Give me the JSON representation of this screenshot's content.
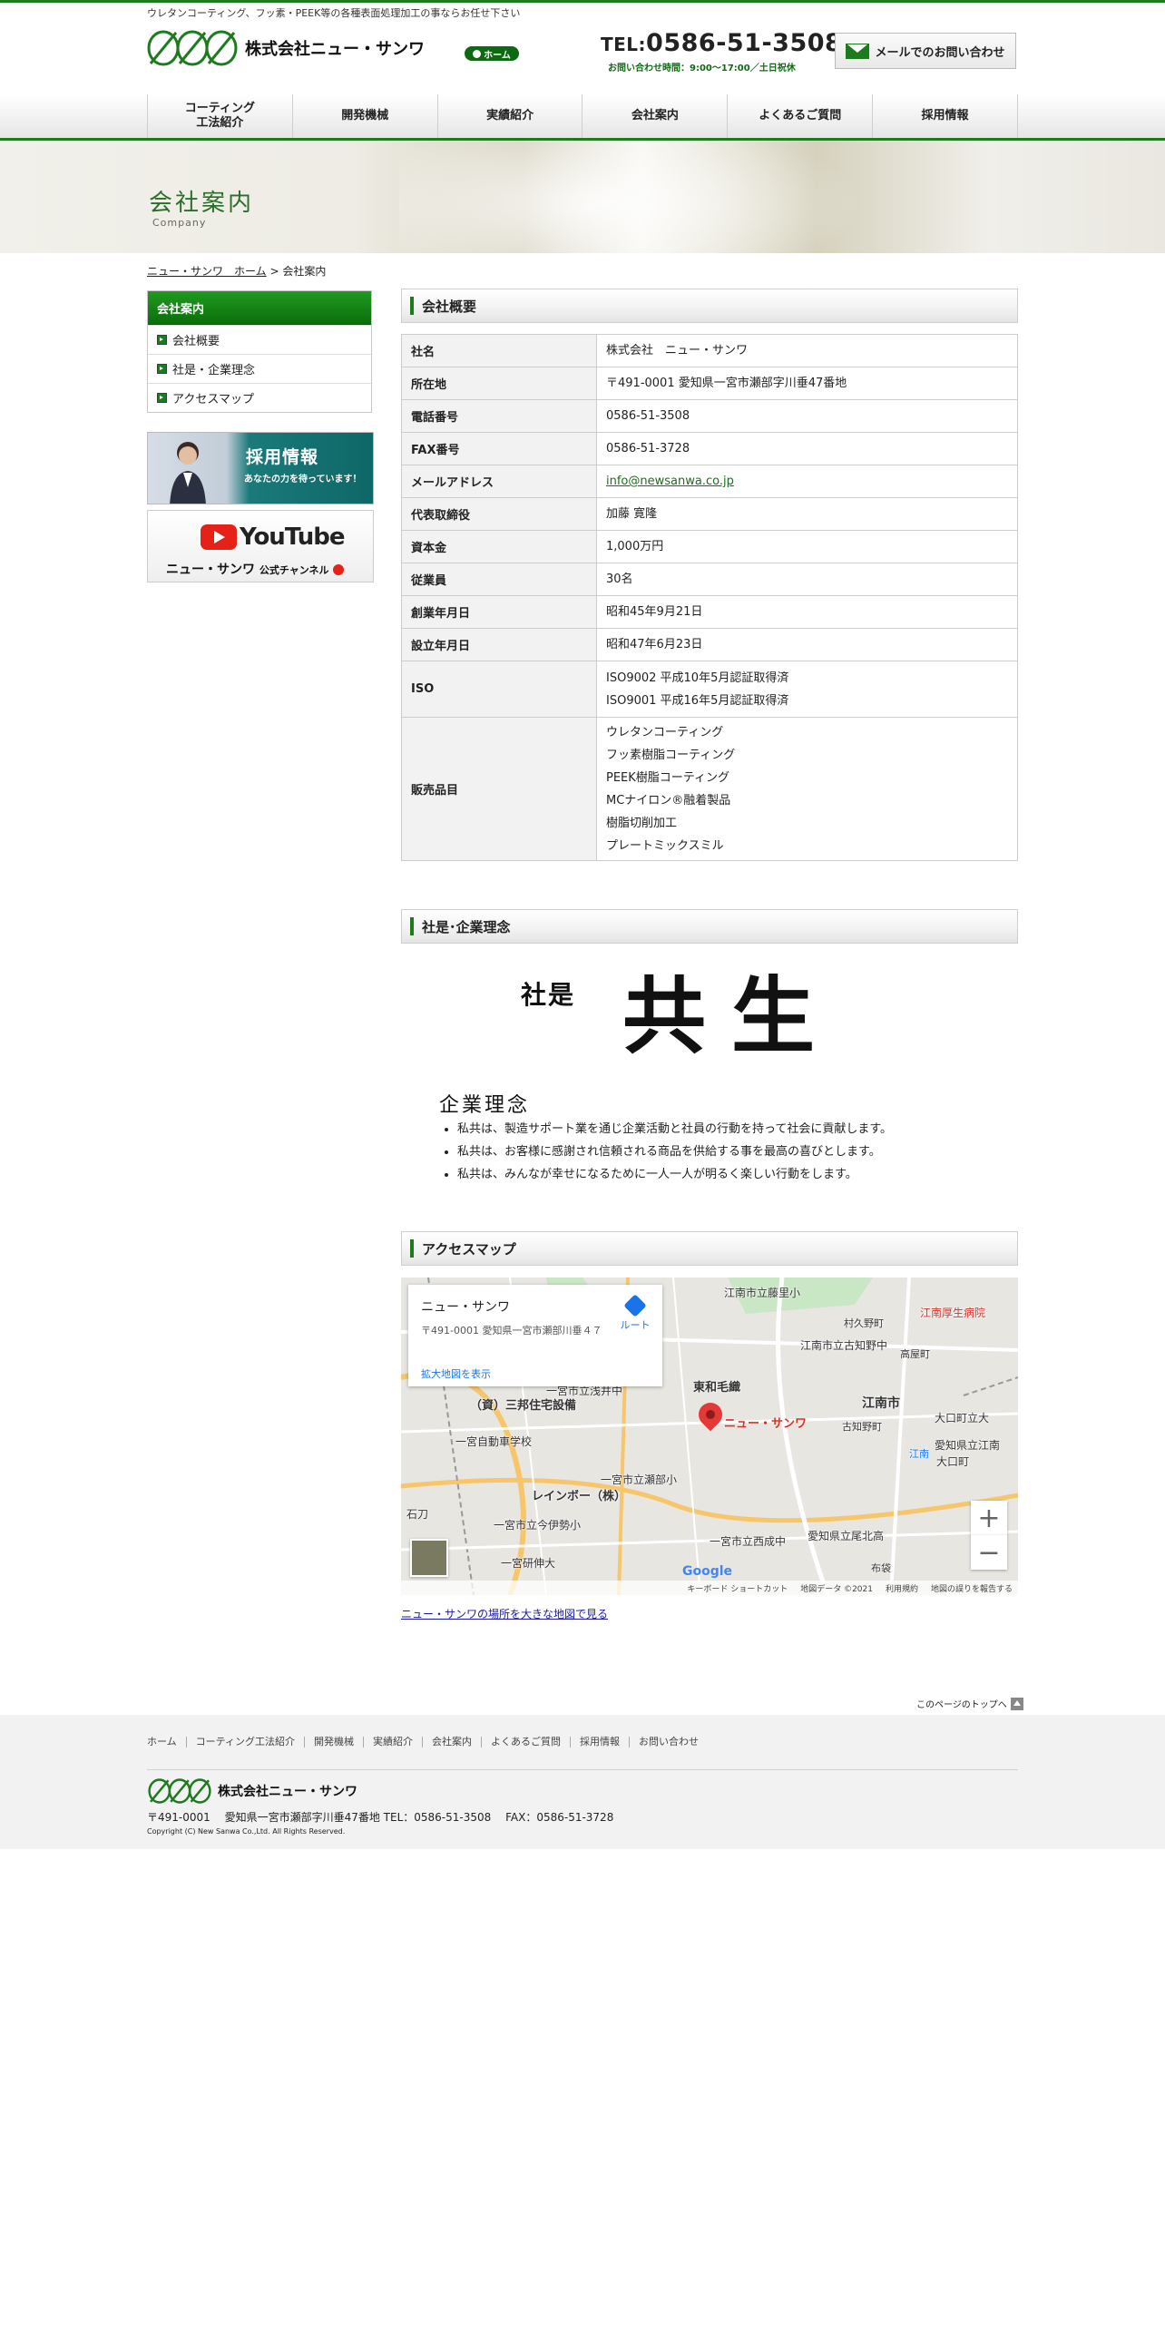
{
  "header": {
    "tagline": "ウレタンコーティング、フッ素・PEEK等の各種表面処理加工の事ならお任せ下さい",
    "company_name": "株式会社ニュー・サンワ",
    "home_label": "ホーム",
    "tel_label": "TEL:",
    "tel_number": "0586-51-3508",
    "tel_hours": "お問い合わせ時間：9:00〜17:00／土日祝休",
    "mail_button": "メールでのお問い合わせ"
  },
  "nav": {
    "items": [
      {
        "label": "コーティング\n工法紹介"
      },
      {
        "label": "開発機械"
      },
      {
        "label": "実績紹介"
      },
      {
        "label": "会社案内"
      },
      {
        "label": "よくあるご質問"
      },
      {
        "label": "採用情報"
      }
    ]
  },
  "banner": {
    "title": "会社案内",
    "subtitle": "Company"
  },
  "breadcrumb": {
    "home": "ニュー・サンワ　ホーム",
    "separator": ">",
    "current": "会社案内"
  },
  "sidebar": {
    "heading": "会社案内",
    "items": [
      {
        "label": "会社概要"
      },
      {
        "label": "社是・企業理念"
      },
      {
        "label": "アクセスマップ"
      }
    ],
    "recruit_title": "採用情報",
    "recruit_sub": "あなたの力を待っています！",
    "youtube_word": "YouTube",
    "youtube_channel": "ニュー・サンワ",
    "youtube_channel_suffix": "公式チャンネル"
  },
  "overview": {
    "heading": "会社概要",
    "rows": [
      {
        "label": "社名",
        "value": "株式会社　ニュー・サンワ"
      },
      {
        "label": "所在地",
        "value": "〒491-0001 愛知県一宮市瀬部字川垂47番地"
      },
      {
        "label": "電話番号",
        "value": "0586-51-3508"
      },
      {
        "label": "FAX番号",
        "value": "0586-51-3728"
      },
      {
        "label": "メールアドレス",
        "value": "info@newsanwa.co.jp"
      },
      {
        "label": "代表取締役",
        "value": "加藤 寛隆"
      },
      {
        "label": "資本金",
        "value": "1,000万円"
      },
      {
        "label": "従業員",
        "value": "30名"
      },
      {
        "label": "創業年月日",
        "value": "昭和45年9月21日"
      },
      {
        "label": "設立年月日",
        "value": "昭和47年6月23日"
      },
      {
        "label": "ISO",
        "lines": [
          "ISO9002 平成10年5月認証取得済",
          "ISO9001 平成16年5月認証取得済"
        ]
      },
      {
        "label": "販売品目",
        "lines": [
          "ウレタンコーティング",
          "フッ素樹脂コーティング",
          "PEEK樹脂コーティング",
          "MCナイロン®融着製品",
          "樹脂切削加工",
          "プレートミックスミル"
        ]
      }
    ]
  },
  "philosophy": {
    "heading": "社是･企業理念",
    "motto_label": "社是",
    "motto": "共生",
    "title": "企業理念",
    "items": [
      "私共は、製造サポート業を通じ企業活動と社員の行動を持って社会に貢献します。",
      "私共は、お客様に感謝され信頼される商品を供給する事を最高の喜びとします。",
      "私共は、みんなが幸せになるために一人一人が明るく楽しい行動をします。"
    ]
  },
  "access": {
    "heading": "アクセスマップ",
    "card_name": "ニュー・サンワ",
    "card_address": "〒491-0001 愛知県一宮市瀬部川垂４７",
    "route_label": "ルート",
    "larger_map": "拡大地図を表示",
    "pin_label": "ニュー・サンワ",
    "labels": [
      "江南市立藤里小",
      "江南厚生病院",
      "村久野町",
      "江南市立古知野中",
      "高屋町",
      "東和毛織",
      "江南市",
      "一宮市立浅井中",
      "（資）三邦住宅設備",
      "一宮自動車学校",
      "古知野町",
      "大口町立大",
      "愛知県立江南",
      "大口町",
      "江南",
      "レインボー（株）",
      "一宮市立瀬部小",
      "石刀",
      "一宮市立今伊勢小",
      "一宮市立西成中",
      "愛知県立尾北高",
      "一宮研伸大",
      "布袋"
    ],
    "google": "Google",
    "footer_items": [
      "キーボード ショートカット",
      "地図データ ©2021",
      "利用規約",
      "地図の誤りを報告する"
    ],
    "link": "ニュー・サンワの場所を大きな地図で見る"
  },
  "pagetop": "このページのトップへ",
  "footer": {
    "nav": [
      "ホーム",
      "コーティング工法紹介",
      "開発機械",
      "実績紹介",
      "会社案内",
      "よくあるご質問",
      "採用情報",
      "お問い合わせ"
    ],
    "company_name": "株式会社ニュー・サンワ",
    "address": "〒491-0001　 愛知県一宮市瀬部字川垂47番地 TEL：0586-51-3508　 FAX：0586-51-3728",
    "copyright": "Copyright (C) New Sanwa Co.,Ltd. All Rights Reserved."
  },
  "colors": {
    "brand_green": "#1d7a1d",
    "map_pin": "#e53935"
  }
}
